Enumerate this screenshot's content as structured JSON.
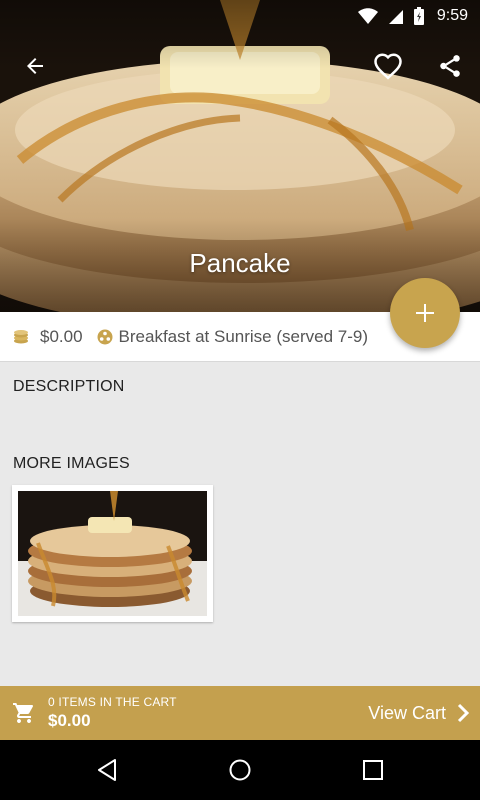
{
  "status_bar": {
    "time": "9:59"
  },
  "header": {
    "title": "Pancake"
  },
  "info": {
    "price": "$0.00",
    "category": "Breakfast at Sunrise (served 7-9)"
  },
  "sections": {
    "description_label": "DESCRIPTION",
    "more_images_label": "MORE IMAGES"
  },
  "cart": {
    "count_label": "0 ITEMS IN THE CART",
    "total": "$0.00",
    "view_label": "View Cart"
  },
  "icons": {
    "back": "arrow-back-icon",
    "favorite": "heart-icon",
    "share": "share-icon",
    "add": "plus-icon",
    "price": "coins-icon",
    "category": "category-icon",
    "cart": "shopping-cart-icon",
    "view_cart": "chevron-right-icon"
  },
  "colors": {
    "accent": "#c8a44e",
    "cart_bar": "#c4a04e",
    "background": "#e9e9e9"
  }
}
